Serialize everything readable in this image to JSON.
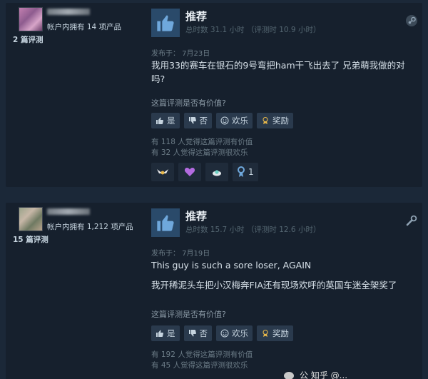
{
  "reviews": [
    {
      "owned": "帐户内拥有 14 项产品",
      "review_count": "2 篇评测",
      "recommendation": "推荐",
      "hours": "总时数 31.1 小时 （评测时 10.9 小时）",
      "posted": "发布于： 7月23日",
      "content": [
        "我用33的赛车在银石的9号弯把ham干飞出去了 兄弟萌我做的对吗?"
      ],
      "helpful_question": "这篇评测是否有价值?",
      "buttons": {
        "yes": "是",
        "no": "否",
        "funny": "欢乐",
        "award": "奖励"
      },
      "helpful_stat": "有 118 人觉得这篇评测有价值",
      "funny_stat": "有 32 人觉得这篇评测很欢乐",
      "award_count": "1"
    },
    {
      "owned": "帐户内拥有 1,212 项产品",
      "review_count": "15 篇评测",
      "recommendation": "推荐",
      "hours": "总时数 15.7 小时 （评测时 12.6 小时）",
      "posted": "发布于： 7月19日",
      "content": [
        "This guy is such a sore loser, AGAIN",
        "我开稀泥头车把小汉梅奔FIA还有现场欢呼的英国车迷全架奖了"
      ],
      "helpful_question": "这篇评测是否有价值?",
      "buttons": {
        "yes": "是",
        "no": "否",
        "funny": "欢乐",
        "award": "奖励"
      },
      "helpful_stat": "有 192 人觉得这篇评测有价值",
      "funny_stat": "有 45 人觉得这篇评测很欢乐"
    }
  ],
  "watermark": "公 知乎 @...",
  "colors": {
    "background": "#1b2838",
    "card": "#16202d",
    "thumb_box": "#2a4a6a",
    "button": "#2a3a4d",
    "award_gold": "#e8b84a"
  }
}
